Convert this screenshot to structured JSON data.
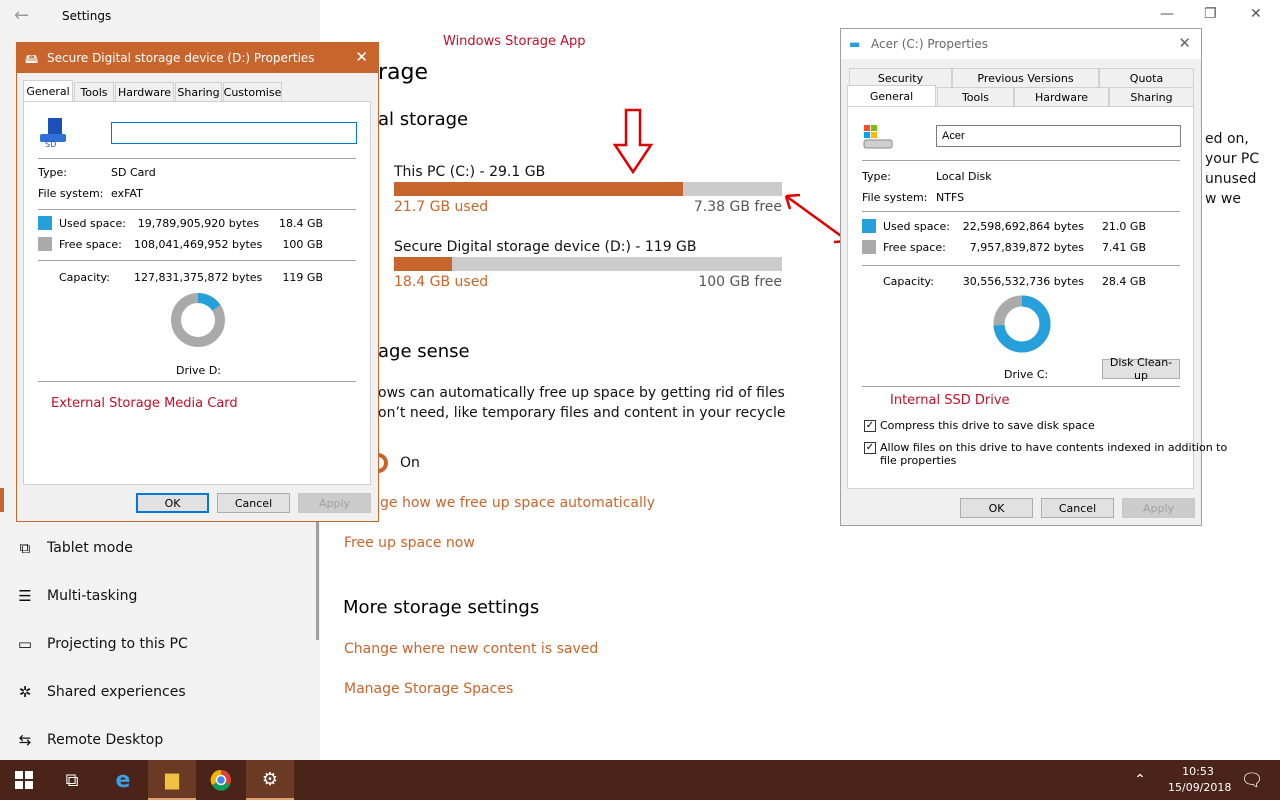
{
  "settings": {
    "title": "Settings",
    "sidebar": {
      "items": [
        {
          "label": "Tablet mode",
          "icon": "tablet-mode-icon"
        },
        {
          "label": "Multi-tasking",
          "icon": "multitasking-icon"
        },
        {
          "label": "Projecting to this PC",
          "icon": "projecting-icon"
        },
        {
          "label": "Shared experiences",
          "icon": "shared-experiences-icon"
        },
        {
          "label": "Remote Desktop",
          "icon": "remote-desktop-icon"
        }
      ]
    },
    "main": {
      "page_title_fragment": "rage",
      "local_storage_fragment": "al storage",
      "drives": [
        {
          "name": "This PC (C:) - 29.1 GB",
          "used": "21.7 GB used",
          "free": "7.38 GB free",
          "fill": 0.746
        },
        {
          "name": "Secure Digital storage device (D:) - 119 GB",
          "used": "18.4 GB used",
          "free": "100 GB free",
          "fill": 0.149
        }
      ],
      "storage_sense_fragment": "age sense",
      "sense_desc_line1": "ows can automatically free up space by getting rid of files",
      "sense_desc_line2": "on’t need, like temporary files and content in your recycle",
      "toggle_state": "On",
      "change_link_fragment": "ge how we free up space automatically",
      "free_up_link": "Free up space now",
      "more_title": "More storage settings",
      "change_saved_link": "Change where new content is saved",
      "manage_spaces_link": "Manage Storage Spaces",
      "right_text": [
        "ed on,",
        "your PC",
        "unused",
        "w we"
      ]
    }
  },
  "annotations": {
    "windows_app": "Windows Storage App",
    "external": "External Storage Media Card",
    "internal": "Internal SSD Drive"
  },
  "dialog_d": {
    "title": "Secure Digital storage device (D:) Properties",
    "tabs": [
      "General",
      "Tools",
      "Hardware",
      "Sharing",
      "Customise"
    ],
    "name_value": "",
    "type_label": "Type:",
    "type_value": "SD Card",
    "fs_label": "File system:",
    "fs_value": "exFAT",
    "used_label": "Used space:",
    "used_bytes": "19,789,905,920 bytes",
    "used_gb": "18.4 GB",
    "free_label": "Free space:",
    "free_bytes": "108,041,469,952 bytes",
    "free_gb": "100 GB",
    "cap_label": "Capacity:",
    "cap_bytes": "127,831,375,872 bytes",
    "cap_gb": "119 GB",
    "used_fraction": 0.155,
    "drive_label": "Drive D:",
    "ok": "OK",
    "cancel": "Cancel",
    "apply": "Apply"
  },
  "dialog_c": {
    "title": "Acer (C:) Properties",
    "tabs_top": [
      "Security",
      "Previous Versions",
      "Quota"
    ],
    "tabs_bottom": [
      "General",
      "Tools",
      "Hardware",
      "Sharing"
    ],
    "name_value": "Acer",
    "type_label": "Type:",
    "type_value": "Local Disk",
    "fs_label": "File system:",
    "fs_value": "NTFS",
    "used_label": "Used space:",
    "used_bytes": "22,598,692,864 bytes",
    "used_gb": "21.0 GB",
    "free_label": "Free space:",
    "free_bytes": "7,957,839,872 bytes",
    "free_gb": "7.41 GB",
    "cap_label": "Capacity:",
    "cap_bytes": "30,556,532,736 bytes",
    "cap_gb": "28.4 GB",
    "used_fraction": 0.74,
    "drive_label": "Drive C:",
    "cleanup": "Disk Clean-up",
    "compress": "Compress this drive to save disk space",
    "index_line1": "Allow files on this drive to have contents indexed in addition to",
    "index_line2": "file properties",
    "ok": "OK",
    "cancel": "Cancel",
    "apply": "Apply"
  },
  "taskbar": {
    "time": "10:53",
    "date": "15/09/2018"
  },
  "colors": {
    "accent": "#c8652d",
    "used": "#26a0da",
    "free": "#aaaaaa",
    "annotation": "#c0102a"
  }
}
